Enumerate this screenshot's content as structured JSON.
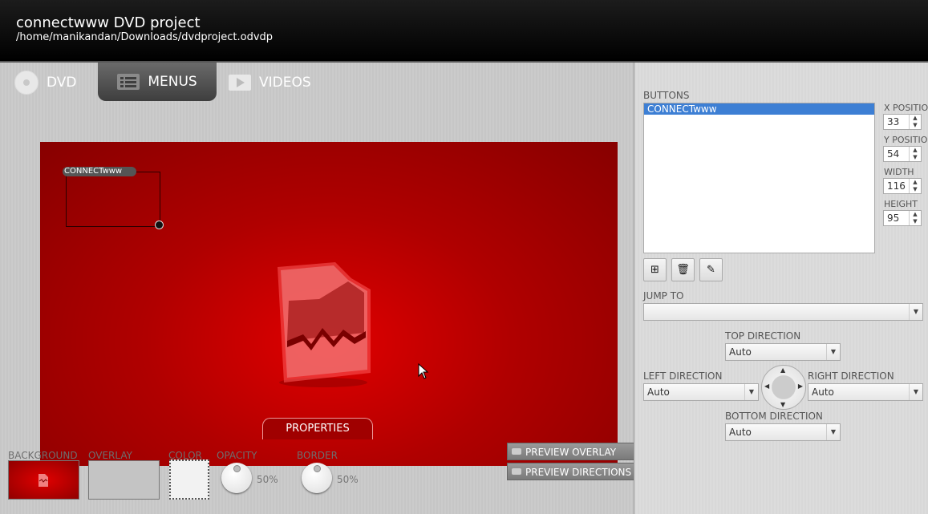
{
  "window": {
    "title": "connectwww DVD project",
    "path": "/home/manikandan/Downloads/dvdproject.odvdp"
  },
  "tabs": [
    {
      "label": "DVD",
      "icon": "disc-icon"
    },
    {
      "label": "MENUS",
      "icon": "menu-list-icon",
      "active": true
    },
    {
      "label": "VIDEOS",
      "icon": "video-play-icon"
    }
  ],
  "canvas": {
    "button_label": "CONNECTwww",
    "background_color": "#b00000"
  },
  "properties": {
    "tab_label": "PROPERTIES",
    "background_label": "BACKGROUND",
    "overlay_label": "OVERLAY",
    "color_label": "COLOR",
    "opacity_label": "OPACITY",
    "opacity_value": "50%",
    "border_label": "BORDER",
    "border_value": "50%",
    "preview_overlay": "PREVIEW OVERLAY",
    "preview_directions": "PREVIEW DIRECTIONS"
  },
  "sidebar": {
    "buttons_label": "BUTTONS",
    "buttons": [
      "CONNECTwww"
    ],
    "x_label": "X POSITIO",
    "x_value": "33",
    "y_label": "Y POSITIO",
    "y_value": "54",
    "width_label": "WIDTH",
    "width_value": "116",
    "height_label": "HEIGHT",
    "height_value": "95",
    "jump_to_label": "JUMP TO",
    "jump_to_value": "",
    "top_direction_label": "TOP DIRECTION",
    "top_direction_value": "Auto",
    "left_direction_label": "LEFT DIRECTION",
    "left_direction_value": "Auto",
    "right_direction_label": "RIGHT DIRECTION",
    "right_direction_value": "Auto",
    "bottom_direction_label": "BOTTOM DIRECTION",
    "bottom_direction_value": "Auto",
    "toolbar_icons": [
      "add-icon",
      "trash-icon",
      "pencil-icon"
    ]
  }
}
